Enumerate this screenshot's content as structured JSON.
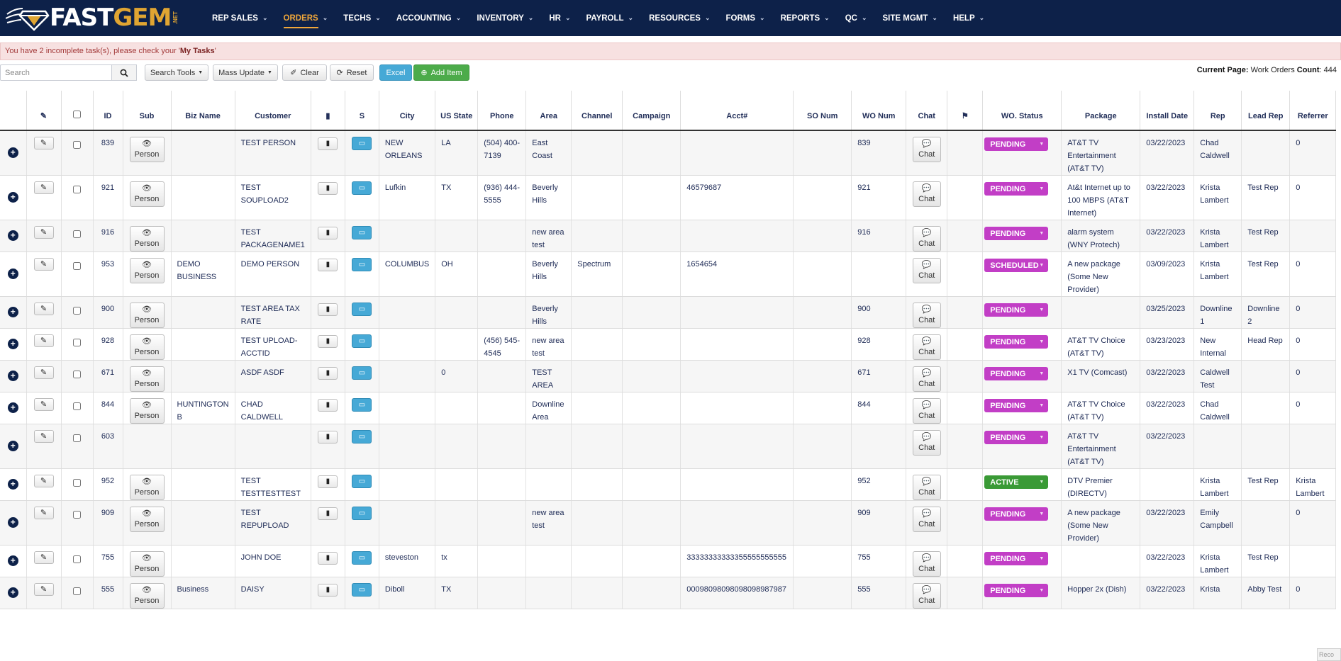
{
  "app": {
    "logo_fast": "FAST",
    "logo_gem": "GEM",
    "logo_net": ".NET"
  },
  "nav": [
    {
      "label": "REP SALES",
      "active": false
    },
    {
      "label": "ORDERS",
      "active": true
    },
    {
      "label": "TECHS",
      "active": false
    },
    {
      "label": "ACCOUNTING",
      "active": false
    },
    {
      "label": "INVENTORY",
      "active": false
    },
    {
      "label": "HR",
      "active": false
    },
    {
      "label": "PAYROLL",
      "active": false
    },
    {
      "label": "RESOURCES",
      "active": false
    },
    {
      "label": "FORMS",
      "active": false
    },
    {
      "label": "REPORTS",
      "active": false
    },
    {
      "label": "QC",
      "active": false
    },
    {
      "label": "SITE MGMT",
      "active": false
    },
    {
      "label": "HELP",
      "active": false
    }
  ],
  "alert": {
    "prefix": "You have 2 incomplete task(s), please check your '",
    "link": "My Tasks",
    "suffix": "'"
  },
  "toolbar": {
    "search_placeholder": "Search",
    "search_tools": "Search Tools",
    "mass_update": "Mass Update",
    "clear": "Clear",
    "reset": "Reset",
    "excel": "Excel",
    "add_item": "Add Item",
    "current_page_label": "Current Page:",
    "current_page_value": "Work Orders",
    "count_label": "Count",
    "count_value": ": 444"
  },
  "columns": [
    "",
    "",
    "",
    "ID",
    "Sub",
    "Biz Name",
    "Customer",
    "",
    "S",
    "City",
    "US State",
    "Phone",
    "Area",
    "Channel",
    "Campaign",
    "Acct#",
    "SO Num",
    "WO Num",
    "Chat",
    "",
    "WO. Status",
    "Package",
    "Install Date",
    "Rep",
    "Lead Rep",
    "Referrer"
  ],
  "labels": {
    "person": "Person",
    "chat": "Chat"
  },
  "rows": [
    {
      "id": "839",
      "person": true,
      "biz": "",
      "customer": "TEST PERSON",
      "city": "NEW ORLEANS",
      "state": "LA",
      "phone": "(504) 400-7139",
      "area": "East Coast",
      "channel": "",
      "campaign": "",
      "acct": "",
      "so": "",
      "wo": "839",
      "status": "PENDING",
      "status_type": "pending",
      "package": "AT&T TV Entertainment (AT&T TV)",
      "install": "03/22/2023",
      "rep": "Chad Caldwell",
      "lead": "",
      "referrer": "0"
    },
    {
      "id": "921",
      "person": true,
      "biz": "",
      "customer": "TEST SOUPLOAD2",
      "city": "Lufkin",
      "state": "TX",
      "phone": "(936) 444-5555",
      "area": "Beverly Hills",
      "channel": "",
      "campaign": "",
      "acct": "46579687",
      "so": "",
      "wo": "921",
      "status": "PENDING",
      "status_type": "pending",
      "package": "At&t Internet up to 100 MBPS (AT&T Internet)",
      "install": "03/22/2023",
      "rep": "Krista Lambert",
      "lead": "Test Rep",
      "referrer": "0"
    },
    {
      "id": "916",
      "person": true,
      "biz": "",
      "customer": "TEST PACKAGENAME1",
      "city": "",
      "state": "",
      "phone": "",
      "area": "new area test",
      "channel": "",
      "campaign": "",
      "acct": "",
      "so": "",
      "wo": "916",
      "status": "PENDING",
      "status_type": "pending",
      "package": "alarm system (WNY Protech)",
      "install": "03/22/2023",
      "rep": "Krista Lambert",
      "lead": "Test Rep",
      "referrer": ""
    },
    {
      "id": "953",
      "person": true,
      "biz": "DEMO BUSINESS",
      "customer": "DEMO PERSON",
      "city": "COLUMBUS",
      "state": "OH",
      "phone": "",
      "area": "Beverly Hills",
      "channel": "Spectrum",
      "campaign": "",
      "acct": "1654654",
      "so": "",
      "wo": "",
      "status": "SCHEDULED",
      "status_type": "scheduled",
      "package": "A new package (Some New Provider)",
      "install": "03/09/2023",
      "rep": "Krista Lambert",
      "lead": "Test Rep",
      "referrer": "0"
    },
    {
      "id": "900",
      "person": true,
      "biz": "",
      "customer": "TEST AREA TAX RATE",
      "city": "",
      "state": "",
      "phone": "",
      "area": "Beverly Hills",
      "channel": "",
      "campaign": "",
      "acct": "",
      "so": "",
      "wo": "900",
      "status": "PENDING",
      "status_type": "pending",
      "package": "",
      "install": "03/25/2023",
      "rep": "Downline 1",
      "lead": "Downline 2",
      "referrer": "0"
    },
    {
      "id": "928",
      "person": true,
      "biz": "",
      "customer": "TEST UPLOAD-ACCTID",
      "city": "",
      "state": "",
      "phone": "(456) 545-4545",
      "area": "new area test",
      "channel": "",
      "campaign": "",
      "acct": "",
      "so": "",
      "wo": "928",
      "status": "PENDING",
      "status_type": "pending",
      "package": "AT&T TV Choice (AT&T TV)",
      "install": "03/23/2023",
      "rep": "New Internal",
      "lead": "Head Rep",
      "referrer": "0"
    },
    {
      "id": "671",
      "person": true,
      "biz": "",
      "customer": "ASDF ASDF",
      "city": "",
      "state": "0",
      "phone": "",
      "area": "TEST AREA",
      "channel": "",
      "campaign": "",
      "acct": "",
      "so": "",
      "wo": "671",
      "status": "PENDING",
      "status_type": "pending",
      "package": "X1 TV (Comcast)",
      "install": "03/22/2023",
      "rep": "Caldwell Test",
      "lead": "",
      "referrer": "0"
    },
    {
      "id": "844",
      "person": true,
      "biz": "HUNTINGTON B",
      "customer": "CHAD CALDWELL",
      "city": "",
      "state": "",
      "phone": "",
      "area": "Downline Area",
      "channel": "",
      "campaign": "",
      "acct": "",
      "so": "",
      "wo": "844",
      "status": "PENDING",
      "status_type": "pending",
      "package": "AT&T TV Choice (AT&T TV)",
      "install": "03/22/2023",
      "rep": "Chad Caldwell",
      "lead": "",
      "referrer": "0"
    },
    {
      "id": "603",
      "person": false,
      "biz": "",
      "customer": "",
      "city": "",
      "state": "",
      "phone": "",
      "area": "",
      "channel": "",
      "campaign": "",
      "acct": "",
      "so": "",
      "wo": "",
      "status": "PENDING",
      "status_type": "pending",
      "package": "AT&T TV Entertainment (AT&T TV)",
      "install": "03/22/2023",
      "rep": "",
      "lead": "",
      "referrer": ""
    },
    {
      "id": "952",
      "person": true,
      "biz": "",
      "customer": "TEST TESTTESTTEST",
      "city": "",
      "state": "",
      "phone": "",
      "area": "",
      "channel": "",
      "campaign": "",
      "acct": "",
      "so": "",
      "wo": "952",
      "status": "ACTIVE",
      "status_type": "active",
      "package": "DTV Premier (DIRECTV)",
      "install": "",
      "rep": "Krista Lambert",
      "lead": "Test Rep",
      "referrer": "Krista Lambert"
    },
    {
      "id": "909",
      "person": true,
      "biz": "",
      "customer": "TEST REPUPLOAD",
      "city": "",
      "state": "",
      "phone": "",
      "area": "new area test",
      "channel": "",
      "campaign": "",
      "acct": "",
      "so": "",
      "wo": "909",
      "status": "PENDING",
      "status_type": "pending",
      "package": "A new package (Some New Provider)",
      "install": "03/22/2023",
      "rep": "Emily Campbell",
      "lead": "",
      "referrer": "0"
    },
    {
      "id": "755",
      "person": true,
      "biz": "",
      "customer": "JOHN DOE",
      "city": "steveston",
      "state": "tx",
      "phone": "",
      "area": "",
      "channel": "",
      "campaign": "",
      "acct": "33333333333355555555555",
      "so": "",
      "wo": "755",
      "status": "PENDING",
      "status_type": "pending",
      "package": "",
      "install": "03/22/2023",
      "rep": "Krista Lambert",
      "lead": "Test Rep",
      "referrer": ""
    },
    {
      "id": "555",
      "person": true,
      "biz": "Business",
      "customer": "DAISY",
      "city": "Diboll",
      "state": "TX",
      "phone": "",
      "area": "",
      "channel": "",
      "campaign": "",
      "acct": "00098098098098098987987",
      "so": "",
      "wo": "555",
      "status": "PENDING",
      "status_type": "pending",
      "package": "Hopper 2x (Dish)",
      "install": "03/22/2023",
      "rep": "Krista",
      "lead": "Abby Test",
      "referrer": "0"
    }
  ],
  "overlay": {
    "corner_text": "Reco"
  }
}
